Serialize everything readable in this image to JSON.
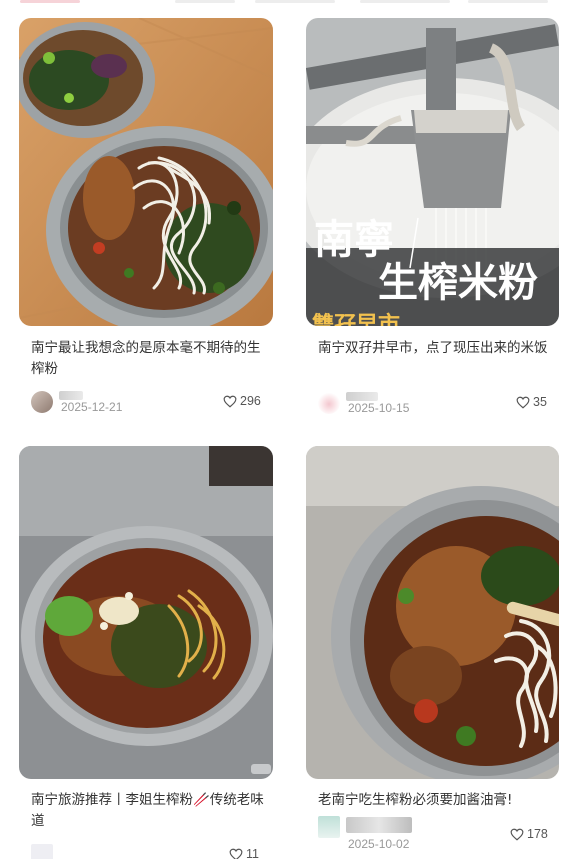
{
  "feed": [
    {
      "title": "南宁最让我想念的是原本毫不期待的生榨粉",
      "date": "2025-12-21",
      "likes": "296"
    },
    {
      "title": "南宁双孖井早市，点了现压出来的米饭",
      "date": "2025-10-15",
      "likes": "35",
      "image_overlay": {
        "line1": "南寧",
        "line2": "生榨米粉",
        "line3": "雙孖早市"
      }
    },
    {
      "title": "南宁旅游推荐丨李姐生榨粉🥢传统老味道",
      "date": "",
      "likes": "11"
    },
    {
      "title": "老南宁吃生榨粉必须要加酱油膏!",
      "date": "2025-10-02",
      "likes": "178"
    }
  ],
  "icons": {
    "like": "heart-outline-icon"
  },
  "colors": {
    "text": "#333333",
    "muted": "#999999",
    "overlay_text": "#ffffff",
    "overlay_tag": "#f2c14e"
  }
}
